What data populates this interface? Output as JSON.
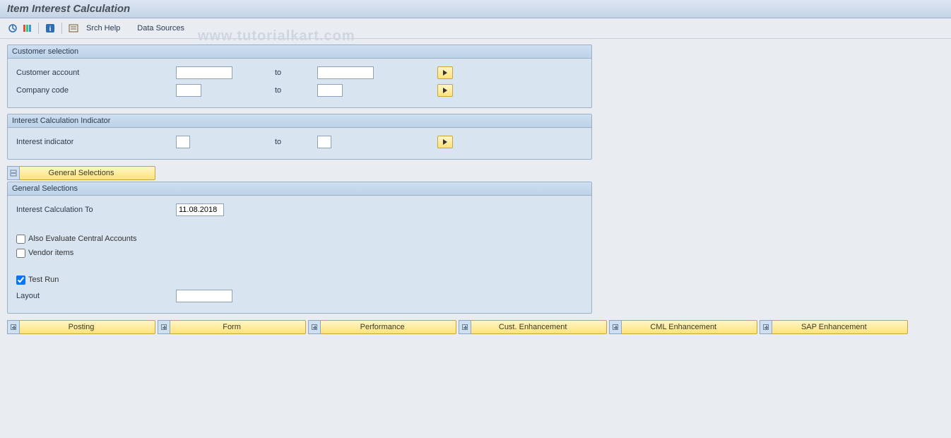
{
  "header": {
    "title": "Item Interest Calculation"
  },
  "watermark": "www.tutorialkart.com",
  "toolbar": {
    "srch_help": "Srch Help",
    "data_sources": "Data Sources"
  },
  "groups": {
    "customer_selection": {
      "title": "Customer selection",
      "customer_account": {
        "label": "Customer account",
        "from": "",
        "to_label": "to",
        "to": ""
      },
      "company_code": {
        "label": "Company code",
        "from": "",
        "to_label": "to",
        "to": ""
      }
    },
    "interest_indicator": {
      "title": "Interest Calculation Indicator",
      "interest_indicator": {
        "label": "Interest indicator",
        "from": "",
        "to_label": "to",
        "to": ""
      }
    },
    "general_selections_button": "General Selections",
    "general_selections": {
      "title": "General Selections",
      "calc_to": {
        "label": "Interest Calculation To",
        "value": "11.08.2018"
      },
      "also_evaluate": {
        "label": "Also Evaluate Central Accounts",
        "checked": false
      },
      "vendor_items": {
        "label": "Vendor items",
        "checked": false
      },
      "test_run": {
        "label": "Test Run",
        "checked": true
      },
      "layout": {
        "label": "Layout",
        "value": ""
      }
    }
  },
  "expand_buttons": [
    "Posting",
    "Form",
    "Performance",
    "Cust. Enhancement",
    "CML Enhancement",
    "SAP Enhancement"
  ]
}
